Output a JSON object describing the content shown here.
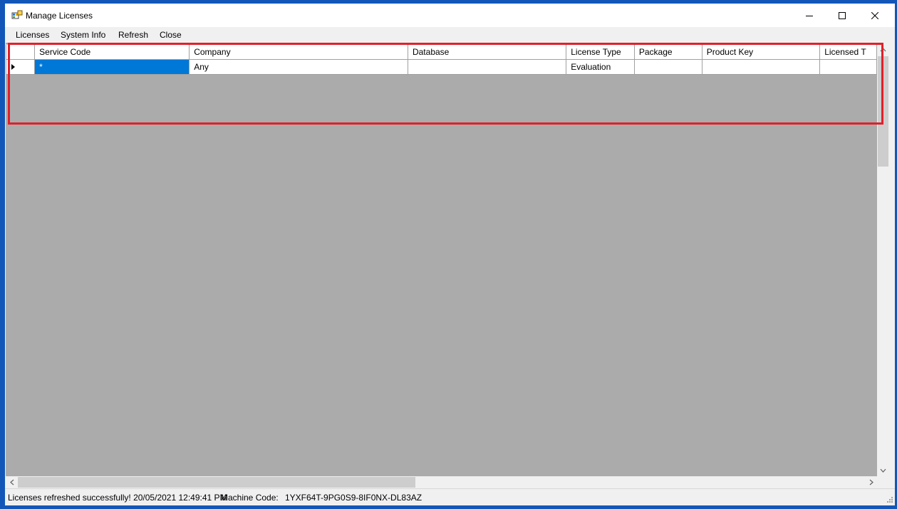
{
  "window": {
    "title": "Manage Licenses"
  },
  "menu": {
    "licenses": "Licenses",
    "system_info": "System Info",
    "refresh": "Refresh",
    "close": "Close"
  },
  "grid": {
    "columns": [
      "Service Code",
      "Company",
      "Database",
      "License Type",
      "Package",
      "Product Key",
      "Licensed T"
    ],
    "rows": [
      {
        "service_code": "*",
        "company": "Any",
        "database": "",
        "license_type": "Evaluation",
        "package": "",
        "product_key": "",
        "licensed_t": ""
      }
    ]
  },
  "status": {
    "message": "Licenses refreshed successfully! 20/05/2021 12:49:41 PM",
    "machine_code_label": "Machine Code:",
    "machine_code_value": "1YXF64T-9PG0S9-8IF0NX-DL83AZ"
  },
  "colors": {
    "desktop": "#1257b8",
    "selection": "#0078d7",
    "grid_background": "#ababab",
    "highlight": "#e0202a"
  },
  "icons": [
    "app-icon",
    "minimize-icon",
    "maximize-icon",
    "close-icon",
    "row-pointer-icon",
    "scroll-up-icon",
    "scroll-down-icon",
    "scroll-left-icon",
    "scroll-right-icon",
    "resize-grip-icon"
  ]
}
